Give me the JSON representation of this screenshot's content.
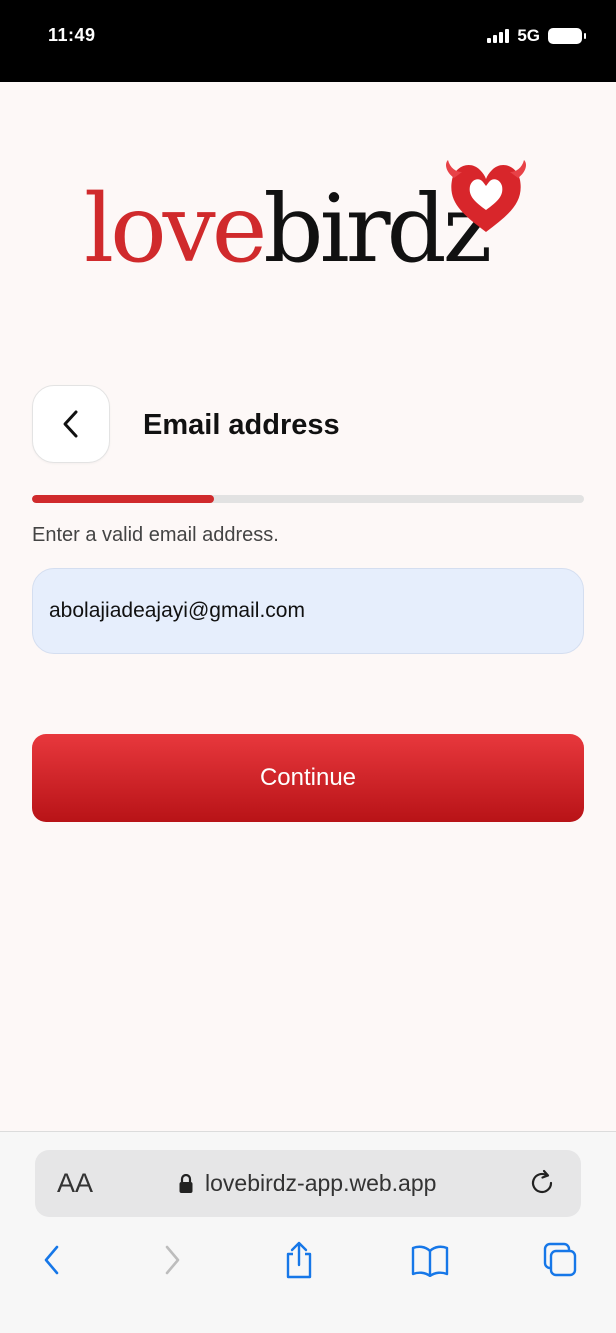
{
  "status_bar": {
    "time": "11:49",
    "network": "5G"
  },
  "logo": {
    "part1": "love",
    "part2": "birdz"
  },
  "header": {
    "title": "Email address"
  },
  "progress": {
    "fraction": 0.33
  },
  "form": {
    "hint": "Enter a valid email address.",
    "email_value": "abolajiadeajayi@gmail.com",
    "continue_label": "Continue"
  },
  "browser": {
    "text_size_label": "AA",
    "url": "lovebirdz-app.web.app"
  },
  "colors": {
    "brand_red": "#d02a2c",
    "accent_blue": "#1677e8"
  }
}
